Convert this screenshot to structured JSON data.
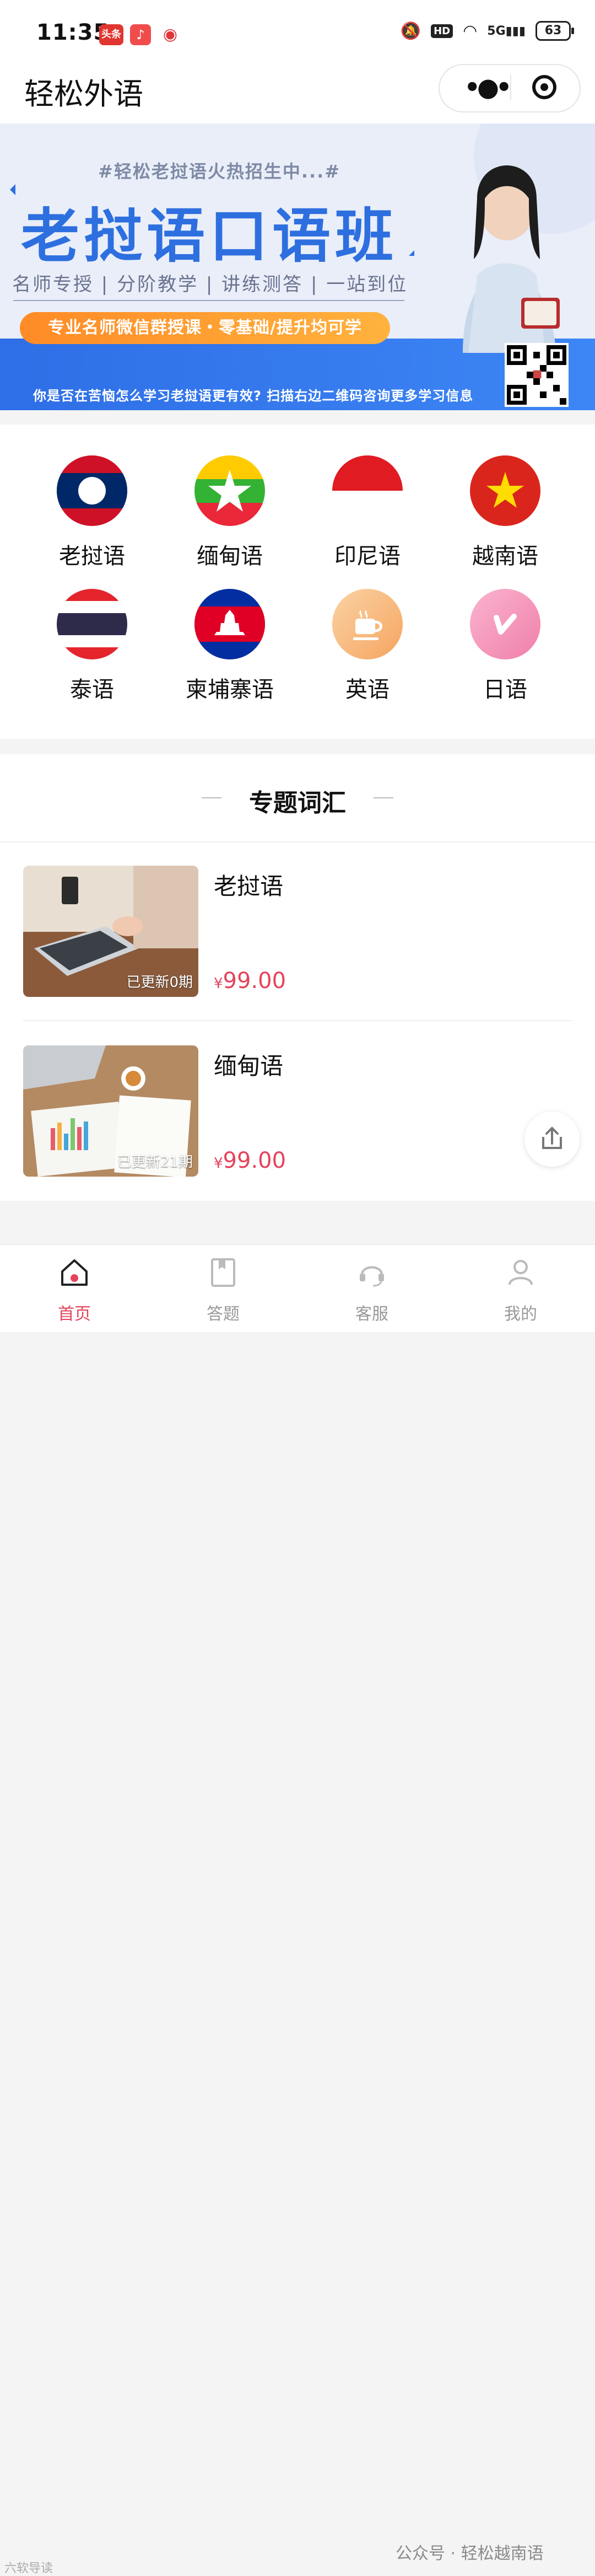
{
  "status_bar": {
    "time": "11:35",
    "notif_1": "头条",
    "network": "5G",
    "battery": "63"
  },
  "header": {
    "title": "轻松外语",
    "more_icon": "more-dots-icon",
    "close_icon": "target-close-icon"
  },
  "banner": {
    "hashtag": "#轻松老挝语火热招生中...#",
    "headline": "老挝语口语班",
    "subline": "名师专授 | 分阶教学 | 讲练测答 | 一站到位",
    "pill": "专业名师微信群授课・零基础/提升均可学",
    "footer": "你是否在苦恼怎么学习老挝语更有效? 扫描右边二维码咨询更多学习信息"
  },
  "languages": [
    {
      "label": "老挝语",
      "icon": "laos-flag-icon"
    },
    {
      "label": "缅甸语",
      "icon": "myanmar-flag-icon"
    },
    {
      "label": "印尼语",
      "icon": "indonesia-flag-icon"
    },
    {
      "label": "越南语",
      "icon": "vietnam-flag-icon"
    },
    {
      "label": "泰语",
      "icon": "thailand-flag-icon"
    },
    {
      "label": "柬埔寨语",
      "icon": "cambodia-flag-icon"
    },
    {
      "label": "英语",
      "icon": "coffee-cup-icon"
    },
    {
      "label": "日语",
      "icon": "pink-logo-icon"
    }
  ],
  "section": {
    "title": "专题词汇"
  },
  "courses": [
    {
      "title": "老挝语",
      "badge": "已更新0期",
      "currency": "¥",
      "price": "99.00"
    },
    {
      "title": "缅甸语",
      "badge": "已更新21期",
      "currency": "¥",
      "price": "99.00"
    }
  ],
  "tabbar": [
    {
      "label": "首页",
      "icon": "home-icon",
      "active": true
    },
    {
      "label": "答题",
      "icon": "bookmark-icon",
      "active": false
    },
    {
      "label": "客服",
      "icon": "headset-icon",
      "active": false
    },
    {
      "label": "我的",
      "icon": "user-icon",
      "active": false
    }
  ],
  "watermark": "公众号 · 轻松越南语",
  "watermark_small": "六软导读",
  "colors": {
    "accent": "#e5435b",
    "banner_blue": "#2e6fe0",
    "pill_orange": "#ff9a2e"
  }
}
